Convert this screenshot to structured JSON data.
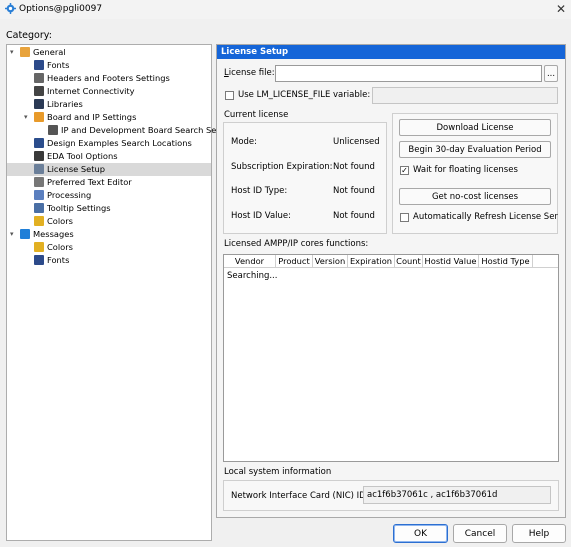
{
  "window": {
    "title": "Options@pgli0097"
  },
  "category_label": "Category:",
  "tree": [
    {
      "label": "General",
      "level": 0,
      "arrow": "expanded",
      "icon": "general-icon",
      "color": "#e8a33c"
    },
    {
      "label": "Fonts",
      "level": 1,
      "icon": "font-icon",
      "color": "#2c4a8a"
    },
    {
      "label": "Headers and Footers Settings",
      "level": 1,
      "icon": "page-icon",
      "color": "#666666"
    },
    {
      "label": "Internet Connectivity",
      "level": 1,
      "icon": "globe-icon",
      "color": "#444444"
    },
    {
      "label": "Libraries",
      "level": 1,
      "icon": "folder-icon",
      "color": "#2b3a55"
    },
    {
      "label": "Board and IP Settings",
      "level": 1,
      "arrow": "expanded",
      "icon": "board-icon",
      "color": "#e89a2a"
    },
    {
      "label": "IP and Development Board Search Setting",
      "level": 2,
      "icon": "board-search-icon",
      "color": "#555555"
    },
    {
      "label": "Design Examples Search Locations",
      "level": 1,
      "icon": "design-icon",
      "color": "#2b4d8c"
    },
    {
      "label": "EDA Tool Options",
      "level": 1,
      "icon": "eda-icon",
      "color": "#3a3a3a"
    },
    {
      "label": "License Setup",
      "level": 1,
      "icon": "license-icon",
      "color": "#6b7f99",
      "selected": true
    },
    {
      "label": "Preferred Text Editor",
      "level": 1,
      "icon": "text-editor-icon",
      "color": "#777777"
    },
    {
      "label": "Processing",
      "level": 1,
      "icon": "processing-icon",
      "color": "#5b7fbf"
    },
    {
      "label": "Tooltip Settings",
      "level": 1,
      "icon": "tooltip-icon",
      "color": "#4a6fa5"
    },
    {
      "label": "Colors",
      "level": 1,
      "icon": "colors-icon",
      "color": "#e2b022"
    },
    {
      "label": "Messages",
      "level": 0,
      "arrow": "expanded",
      "icon": "messages-icon",
      "color": "#1f7fd8"
    },
    {
      "label": "Colors",
      "level": 1,
      "icon": "colors-icon",
      "color": "#e2b022"
    },
    {
      "label": "Fonts",
      "level": 1,
      "icon": "font-icon",
      "color": "#2c4a8a"
    }
  ],
  "panel": {
    "header": "License Setup",
    "license_file_label": "License file:",
    "license_file_value": "",
    "browse_label": "...",
    "use_env_label": "Use LM_LICENSE_FILE variable:",
    "use_env_checked": false,
    "env_value": "",
    "current_license_label": "Current license",
    "current_license": {
      "mode_label": "Mode:",
      "mode_value": "Unlicensed",
      "sub_label": "Subscription Expiration:",
      "sub_value": "Not found",
      "hostid_type_label": "Host ID Type:",
      "hostid_type_value": "Not found",
      "hostid_value_label": "Host ID Value:",
      "hostid_value_value": "Not found"
    },
    "download_license": "Download License",
    "eval_period": "Begin 30-day Evaluation Period",
    "wait_floating_label": "Wait for floating licenses",
    "wait_floating_checked": true,
    "get_nocost": "Get no-cost licenses",
    "auto_refresh_label": "Automatically Refresh License Ser",
    "auto_refresh_checked": false,
    "cores_label": "Licensed AMPP/IP cores functions:",
    "table_headers": [
      "Vendor",
      "Product",
      "Version",
      "Expiration",
      "Count",
      "Hostid Value",
      "Hostid Type"
    ],
    "table_status": "Searching...",
    "local_info_label": "Local system information",
    "nic_label": "Network Interface Card (NIC) ID:",
    "nic_value": "ac1f6b37061c , ac1f6b37061d"
  },
  "buttons": {
    "ok": "OK",
    "cancel": "Cancel",
    "help": "Help"
  },
  "colors": {
    "header_blue": "#1565d8",
    "selection_gray": "#d9d9d9"
  }
}
